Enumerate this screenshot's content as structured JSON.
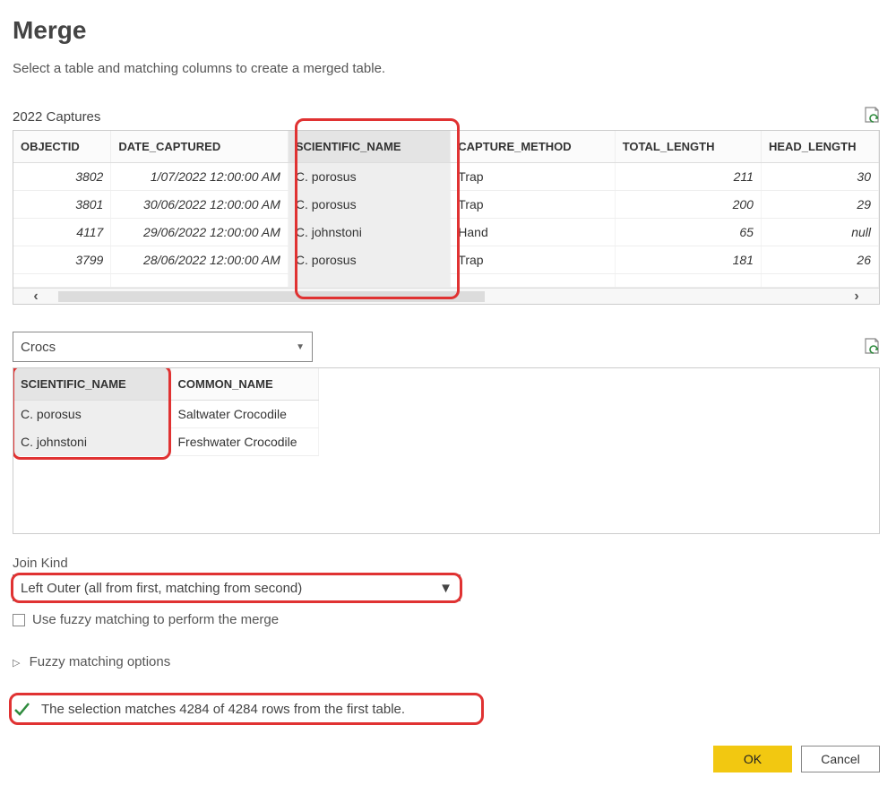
{
  "title": "Merge",
  "subtitle": "Select a table and matching columns to create a merged table.",
  "table1": {
    "label": "2022 Captures",
    "headers": [
      "OBJECTID",
      "DATE_CAPTURED",
      "SCIENTIFIC_NAME",
      "CAPTURE_METHOD",
      "TOTAL_LENGTH",
      "HEAD_LENGTH"
    ],
    "rows": [
      {
        "objectid": "3802",
        "date": "1/07/2022 12:00:00 AM",
        "scientific": "C. porosus",
        "method": "Trap",
        "total": "211",
        "head": "30"
      },
      {
        "objectid": "3801",
        "date": "30/06/2022 12:00:00 AM",
        "scientific": "C. porosus",
        "method": "Trap",
        "total": "200",
        "head": "29"
      },
      {
        "objectid": "4117",
        "date": "29/06/2022 12:00:00 AM",
        "scientific": "C. johnstoni",
        "method": "Hand",
        "total": "65",
        "head": "null"
      },
      {
        "objectid": "3799",
        "date": "28/06/2022 12:00:00 AM",
        "scientific": "C. porosus",
        "method": "Trap",
        "total": "181",
        "head": "26"
      }
    ]
  },
  "select2": {
    "value": "Crocs"
  },
  "table2": {
    "headers": [
      "SCIENTIFIC_NAME",
      "COMMON_NAME"
    ],
    "rows": [
      {
        "scientific": "C. porosus",
        "common": "Saltwater Crocodile"
      },
      {
        "scientific": "C. johnstoni",
        "common": "Freshwater Crocodile"
      }
    ]
  },
  "joinKind": {
    "label": "Join Kind",
    "value": "Left Outer (all from first, matching from second)"
  },
  "fuzzyCheckbox": "Use fuzzy matching to perform the merge",
  "fuzzyExpander": "Fuzzy matching options",
  "statusText": "The selection matches 4284 of 4284 rows from the first table.",
  "buttons": {
    "ok": "OK",
    "cancel": "Cancel"
  },
  "icons": {
    "refresh": "refresh-icon",
    "check": "check-icon"
  }
}
